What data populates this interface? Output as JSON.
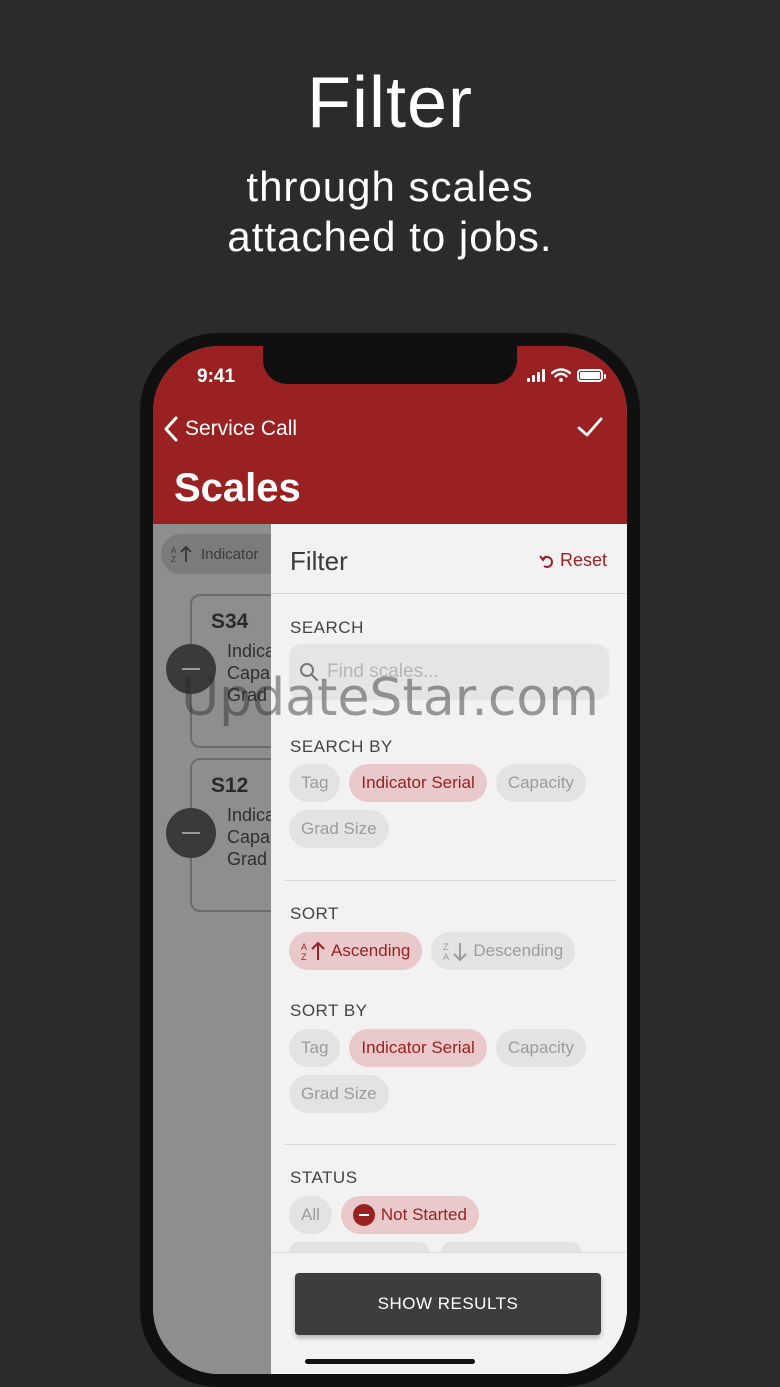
{
  "promo": {
    "title": "Filter",
    "subtitle_line1": "through scales",
    "subtitle_line2": "attached to jobs."
  },
  "status_bar": {
    "time": "9:41"
  },
  "nav": {
    "back_label": "Service Call",
    "title": "Scales"
  },
  "background_list": {
    "sort_label": "Indicator",
    "cards": [
      {
        "tag": "S34",
        "lines": [
          "Indica",
          "Capa",
          "Grad"
        ]
      },
      {
        "tag": "S12",
        "lines": [
          "Indica",
          "Capa",
          "Grad"
        ]
      }
    ]
  },
  "filter": {
    "title": "Filter",
    "reset_label": "Reset",
    "search_label": "SEARCH",
    "search_placeholder": "Find scales...",
    "search_by_label": "SEARCH BY",
    "search_by_options": [
      "Tag",
      "Indicator Serial",
      "Capacity",
      "Grad Size"
    ],
    "search_by_selected": "Indicator Serial",
    "sort_label": "SORT",
    "sort_options": [
      "Ascending",
      "Descending"
    ],
    "sort_selected": "Ascending",
    "sort_by_label": "SORT BY",
    "sort_by_options": [
      "Tag",
      "Indicator Serial",
      "Capacity",
      "Grad Size"
    ],
    "sort_by_selected": "Indicator Serial",
    "status_label": "STATUS",
    "status_options": [
      "All",
      "Not Started"
    ],
    "status_selected": "Not Started",
    "show_results_label": "SHOW RESULTS"
  },
  "watermark": "UpdateStar.com",
  "colors": {
    "accent": "#9a2122",
    "background": "#2b2b2b",
    "chip_active_bg": "#e9c9c9"
  }
}
